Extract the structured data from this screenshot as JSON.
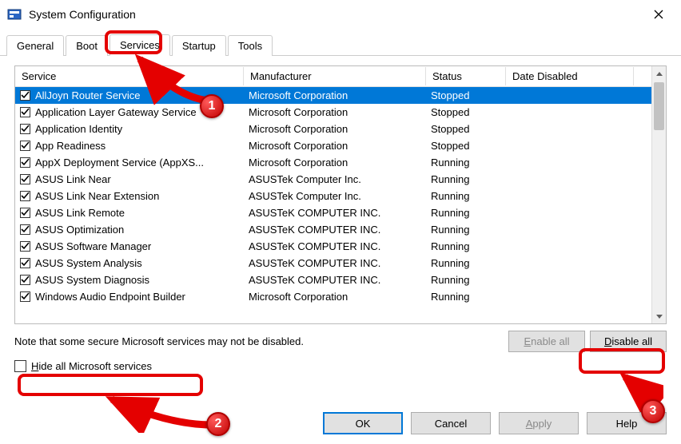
{
  "window": {
    "title": "System Configuration"
  },
  "tabs": [
    "General",
    "Boot",
    "Services",
    "Startup",
    "Tools"
  ],
  "active_tab": 2,
  "columns": {
    "service": "Service",
    "manufacturer": "Manufacturer",
    "status": "Status",
    "date_disabled": "Date Disabled"
  },
  "services": [
    {
      "checked": true,
      "name": "AllJoyn Router Service",
      "manufacturer": "Microsoft Corporation",
      "status": "Stopped",
      "selected": true
    },
    {
      "checked": true,
      "name": "Application Layer Gateway Service",
      "manufacturer": "Microsoft Corporation",
      "status": "Stopped"
    },
    {
      "checked": true,
      "name": "Application Identity",
      "manufacturer": "Microsoft Corporation",
      "status": "Stopped"
    },
    {
      "checked": true,
      "name": "App Readiness",
      "manufacturer": "Microsoft Corporation",
      "status": "Stopped"
    },
    {
      "checked": true,
      "name": "AppX Deployment Service (AppXS...",
      "manufacturer": "Microsoft Corporation",
      "status": "Running"
    },
    {
      "checked": true,
      "name": "ASUS Link Near",
      "manufacturer": "ASUSTek Computer Inc.",
      "status": "Running"
    },
    {
      "checked": true,
      "name": "ASUS Link Near Extension",
      "manufacturer": "ASUSTek Computer Inc.",
      "status": "Running"
    },
    {
      "checked": true,
      "name": "ASUS Link Remote",
      "manufacturer": "ASUSTeK COMPUTER INC.",
      "status": "Running"
    },
    {
      "checked": true,
      "name": "ASUS Optimization",
      "manufacturer": "ASUSTeK COMPUTER INC.",
      "status": "Running"
    },
    {
      "checked": true,
      "name": "ASUS Software Manager",
      "manufacturer": "ASUSTeK COMPUTER INC.",
      "status": "Running"
    },
    {
      "checked": true,
      "name": "ASUS System Analysis",
      "manufacturer": "ASUSTeK COMPUTER INC.",
      "status": "Running"
    },
    {
      "checked": true,
      "name": "ASUS System Diagnosis",
      "manufacturer": "ASUSTeK COMPUTER INC.",
      "status": "Running"
    },
    {
      "checked": true,
      "name": "Windows Audio Endpoint Builder",
      "manufacturer": "Microsoft Corporation",
      "status": "Running"
    }
  ],
  "note": "Note that some secure Microsoft services may not be disabled.",
  "buttons": {
    "enable_all": "Enable all",
    "disable_all": "Disable all",
    "ok": "OK",
    "cancel": "Cancel",
    "apply": "Apply",
    "help": "Help"
  },
  "hide_checkbox": {
    "label": "Hide all Microsoft services",
    "checked": false
  },
  "annotations": {
    "1": "1",
    "2": "2",
    "3": "3"
  }
}
